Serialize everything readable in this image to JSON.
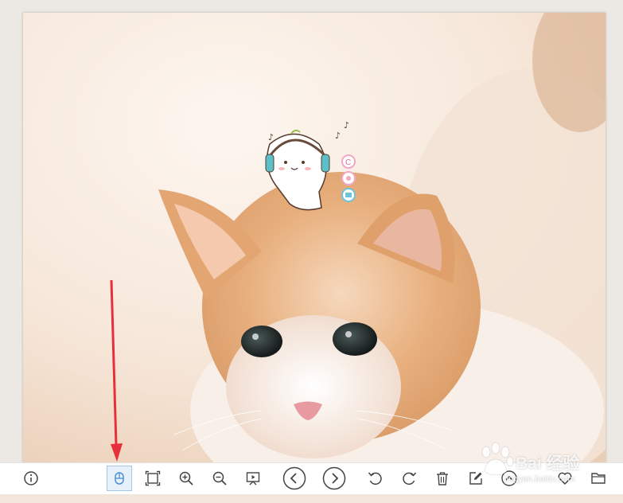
{
  "photo": {
    "description_icon": "kitten-photo",
    "sticker_letter": "C"
  },
  "toolbar": {
    "buttons": [
      {
        "name": "info-button",
        "icon": "info-icon"
      },
      {
        "name": "mouse-mode-button",
        "icon": "mouse-icon",
        "active": true
      },
      {
        "name": "fit-window-button",
        "icon": "fit-frame-icon"
      },
      {
        "name": "zoom-in-button",
        "icon": "zoom-in-icon"
      },
      {
        "name": "zoom-out-button",
        "icon": "zoom-out-icon"
      },
      {
        "name": "slideshow-button",
        "icon": "slideshow-icon"
      },
      {
        "name": "previous-button",
        "icon": "chevron-left-icon"
      },
      {
        "name": "next-button",
        "icon": "chevron-right-icon"
      },
      {
        "name": "rotate-left-button",
        "icon": "rotate-ccw-icon"
      },
      {
        "name": "rotate-right-button",
        "icon": "rotate-cw-icon"
      },
      {
        "name": "delete-button",
        "icon": "trash-icon"
      },
      {
        "name": "edit-button",
        "icon": "edit-icon"
      },
      {
        "name": "more-button",
        "icon": "chevron-up-icon"
      },
      {
        "name": "favorite-button",
        "icon": "heart-icon"
      },
      {
        "name": "open-folder-button",
        "icon": "folder-icon"
      }
    ]
  },
  "watermark": {
    "brand": "Bai  经验",
    "url": "jingyan.baidu.com"
  },
  "colors": {
    "arrow": "#e8303a",
    "accent": "#4a90d9"
  }
}
